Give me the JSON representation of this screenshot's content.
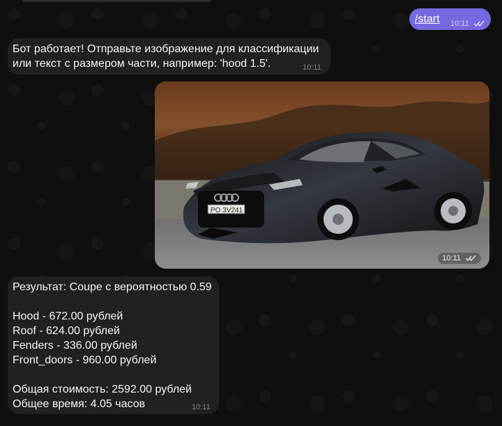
{
  "chat": {
    "outgoing_command": "/start",
    "outgoing_time": "10:11",
    "bot_intro": [
      "Бот работает! Отправьте изображение для классификации",
      "или текст с размером части, например: 'hood 1.5'."
    ],
    "bot_intro_time": "10:11",
    "photo_time": "10:11",
    "photo": {
      "plate_text": "PO 3V241"
    },
    "result": {
      "title": "Результат: Coupe с вероятностью 0.59",
      "items": [
        "Hood - 672.00 рублей",
        "Roof - 624.00 рублей",
        "Fenders - 336.00 рублей",
        "Front_doors - 960.00 рублей"
      ],
      "total_cost": "Общая стоимость: 2592.00 рублей",
      "total_time": "Общее время: 4.05 часов",
      "time": "10:11"
    }
  },
  "colors": {
    "background": "#0f0f10",
    "incoming_bubble": "#212124",
    "outgoing_bubble": "#7668df"
  },
  "icons": {
    "read_receipt": "double-check-icon"
  }
}
